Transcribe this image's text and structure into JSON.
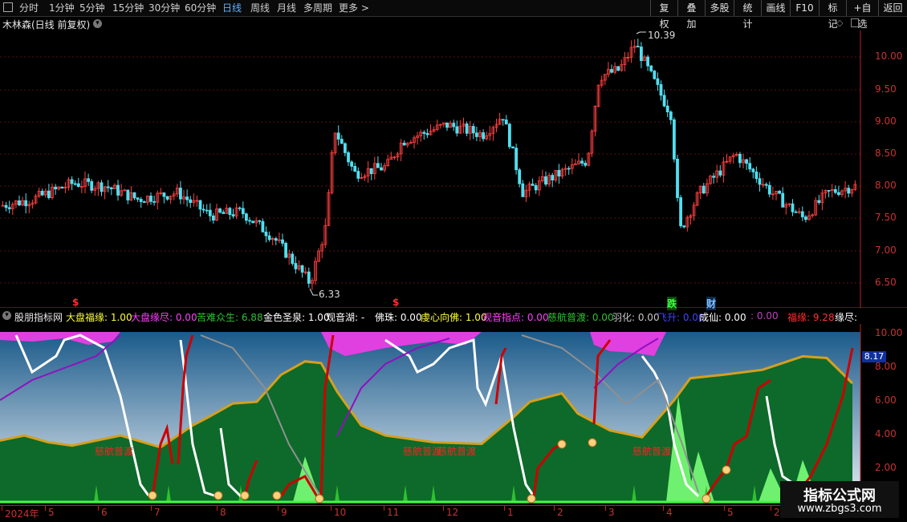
{
  "toolbar": {
    "left": [
      {
        "label": "分时",
        "active": false
      },
      {
        "label": "1分钟",
        "active": false
      },
      {
        "label": "5分钟",
        "active": false
      },
      {
        "label": "15分钟",
        "active": false
      },
      {
        "label": "30分钟",
        "active": false
      },
      {
        "label": "60分钟",
        "active": false
      },
      {
        "label": "日线",
        "active": true
      },
      {
        "label": "周线",
        "active": false
      },
      {
        "label": "月线",
        "active": false
      },
      {
        "label": "多周期",
        "active": false
      },
      {
        "label": "更多",
        "active": false
      }
    ],
    "right": [
      "复权",
      "叠加",
      "多股",
      "统计",
      "画线",
      "F10",
      "标记",
      "+自选",
      "返回"
    ]
  },
  "stock": {
    "title": "木林森(日线 前复权)"
  },
  "price_axis": [
    "10.00",
    "9.50",
    "9.00",
    "8.50",
    "8.00",
    "7.50",
    "7.00",
    "6.50"
  ],
  "price_marks": {
    "high": "10.39",
    "low": "6.33"
  },
  "signals": [
    {
      "text": "$",
      "color": "#ff3030"
    },
    {
      "text": "$",
      "color": "#ff3030"
    },
    {
      "text": "跌",
      "color": "#40ff40"
    },
    {
      "text": "财",
      "color": "#80c0ff"
    }
  ],
  "indicator": {
    "name": "股朋指标网",
    "items": [
      {
        "label": "大盘福缘: 1.00",
        "color": "#ffff40"
      },
      {
        "label": "大盘缘尽: 0.00",
        "color": "#ff40ff"
      },
      {
        "label": "苦难众生: 6.88",
        "color": "#30c030"
      },
      {
        "label": "金色圣泉: 1.00",
        "color": "#ffffff"
      },
      {
        "label": "观音湖: -",
        "color": "#ffffff"
      },
      {
        "label": "佛珠: 0.00",
        "color": "#ffffff"
      },
      {
        "label": "虔心向佛: 1.00",
        "color": "#ffff40"
      },
      {
        "label": "观音指点: 0.00",
        "color": "#ff40ff"
      },
      {
        "label": "慈航普渡: 0.00",
        "color": "#30c030"
      },
      {
        "label": "羽化: 0.00",
        "color": "#c8c8c8"
      },
      {
        "label": "飞升: 0.00",
        "color": "#4040ff"
      },
      {
        "label": "成仙: 0.00",
        "color": "#ffffff"
      },
      {
        "label": ": 0.00",
        "color": "#c040c0"
      },
      {
        "label": "福缘: 9.28",
        "color": "#ff3030"
      },
      {
        "label": "缘尽:",
        "color": "#ffffff"
      }
    ],
    "axis": [
      "10.00",
      "8.00",
      "6.00",
      "4.00",
      "2.00"
    ],
    "current": "8.17",
    "annotations": [
      "慈航普渡",
      "慈航普渡",
      "慈航普渡",
      "慈航普渡"
    ]
  },
  "xaxis": [
    "2024年",
    "5",
    "6",
    "7",
    "8",
    "9",
    "10",
    "11",
    "12",
    "1",
    "2",
    "3",
    "4",
    "5",
    "20"
  ],
  "watermark": {
    "line1": "指标公式网",
    "line2": "www.zbgs3.com"
  }
}
